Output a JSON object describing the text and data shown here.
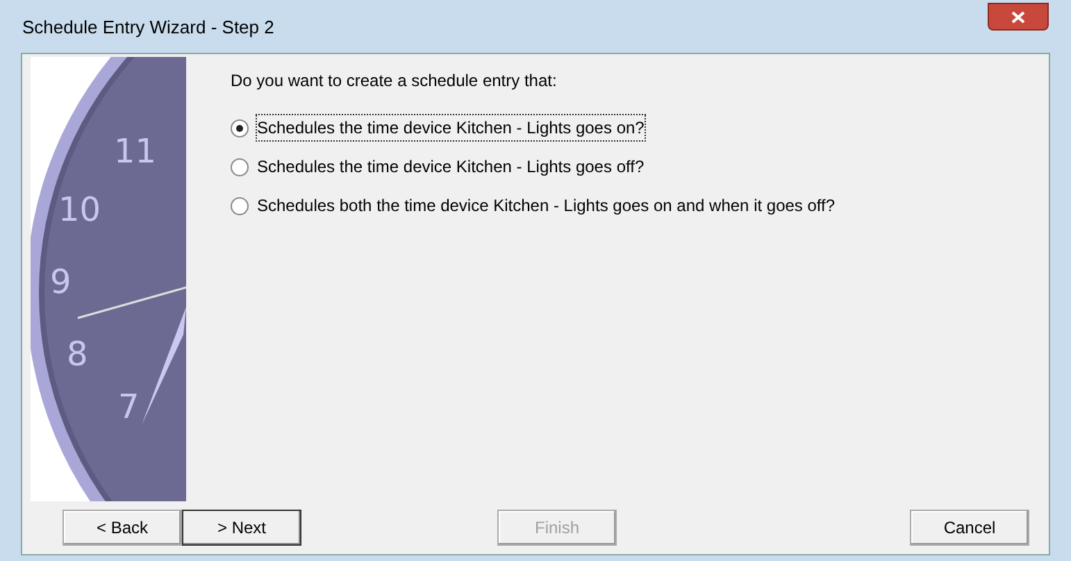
{
  "window": {
    "title": "Schedule Entry Wizard - Step 2"
  },
  "clock": {
    "numerals": [
      "11",
      "10",
      "9",
      "8",
      "7"
    ]
  },
  "question": "Do you want to create a schedule entry that:",
  "options": [
    {
      "label": "Schedules the time device Kitchen - Lights goes on?",
      "selected": true
    },
    {
      "label": "Schedules the time device Kitchen - Lights goes off?",
      "selected": false
    },
    {
      "label": "Schedules both the time device Kitchen - Lights goes on and when it goes off?",
      "selected": false
    }
  ],
  "buttons": [
    {
      "label": "< Back",
      "disabled": false,
      "default": false
    },
    {
      "label": "> Next",
      "disabled": false,
      "default": true
    },
    {
      "label": "Finish",
      "disabled": true,
      "default": false
    },
    {
      "label": "Cancel",
      "disabled": false,
      "default": false
    }
  ]
}
